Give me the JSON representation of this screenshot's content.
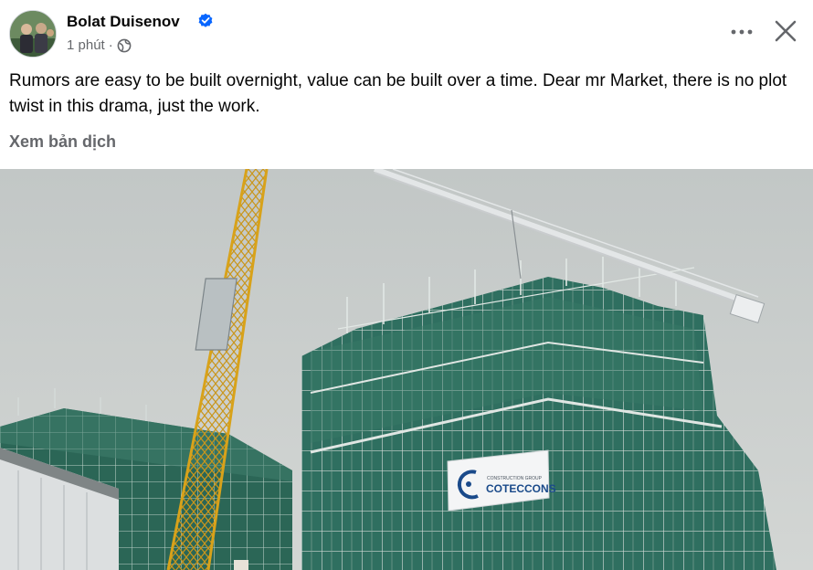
{
  "post": {
    "author": "Bolat Duisenov",
    "time": "1 phút",
    "separator": "·",
    "text": "Rumors are easy to be built overnight, value can be built over a time. Dear mr Market, there is no plot twist in this drama, just the work.",
    "translate_label": "Xem bản dịch"
  },
  "photo": {
    "banner_small_text": "CONSTRUCTION GROUP",
    "banner_text": "COTECCONS"
  },
  "icons": {
    "verified": "verified-badge-icon",
    "privacy": "globe-icon",
    "more": "more-options-icon",
    "close": "close-icon"
  },
  "colors": {
    "verified_blue": "#0866ff",
    "secondary_text": "#65676b",
    "sky": "#c9cdcc",
    "netting_green": "#2e6e5e",
    "crane_yellow": "#d8a21a"
  }
}
